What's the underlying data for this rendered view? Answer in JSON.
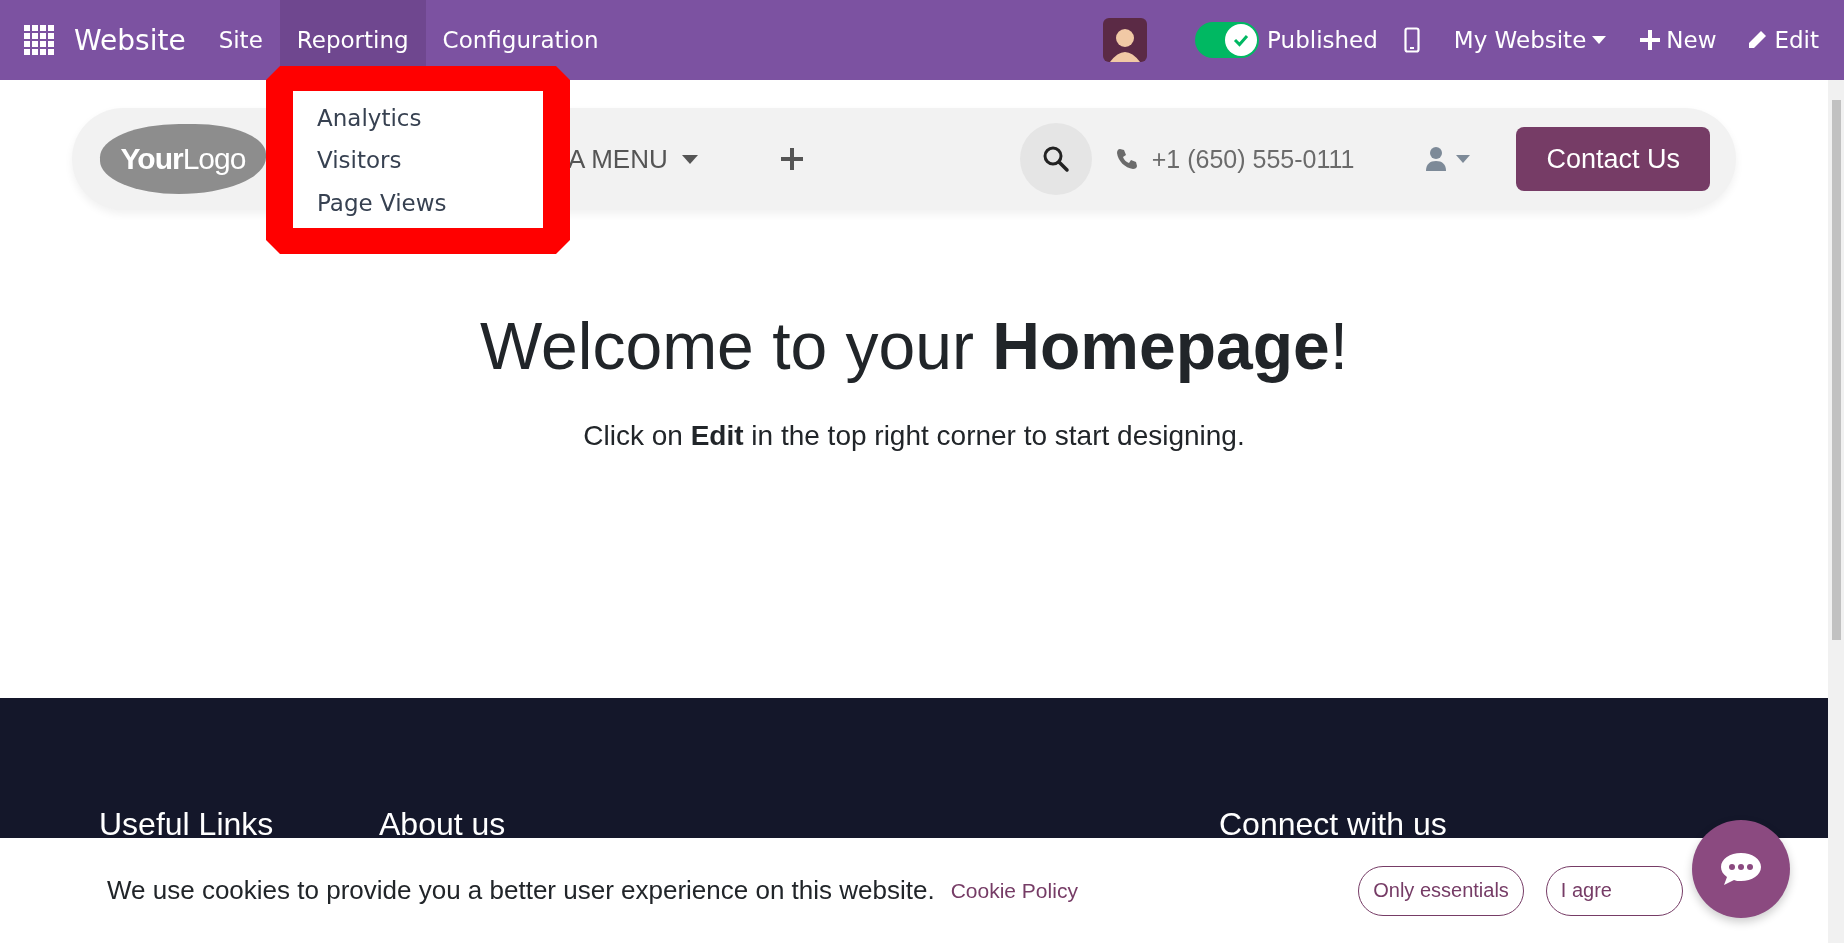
{
  "app_bar": {
    "app_name": "Website",
    "menus": [
      {
        "label": "Site",
        "selected": false
      },
      {
        "label": "Reporting",
        "selected": true
      },
      {
        "label": "Configuration",
        "selected": false
      }
    ],
    "publish_toggle": {
      "label": "Published",
      "on": true
    },
    "website_switcher": "My Website",
    "new_button": "New",
    "edit_button": "Edit"
  },
  "dropdown": {
    "highlighted": true,
    "items": [
      "Analytics",
      "Visitors",
      "Page Views"
    ]
  },
  "site_header": {
    "logo": "**Your**Logo",
    "menu": "A MENU",
    "phone": "+1 (650) 555-0111",
    "cta": "Contact Us"
  },
  "hero": {
    "title": "Welcome to your **Homepage**!",
    "subtitle": "Click on **Edit** in the top right corner to start designing."
  },
  "footer": {
    "headings": [
      "Useful Links",
      "About us",
      "Connect with us"
    ]
  },
  "cookie_bar": {
    "message": "We use cookies to provide you a better user experience on this website.",
    "policy_link": "Cookie Policy",
    "buttons": [
      "Only essentials",
      "I agre"
    ]
  }
}
